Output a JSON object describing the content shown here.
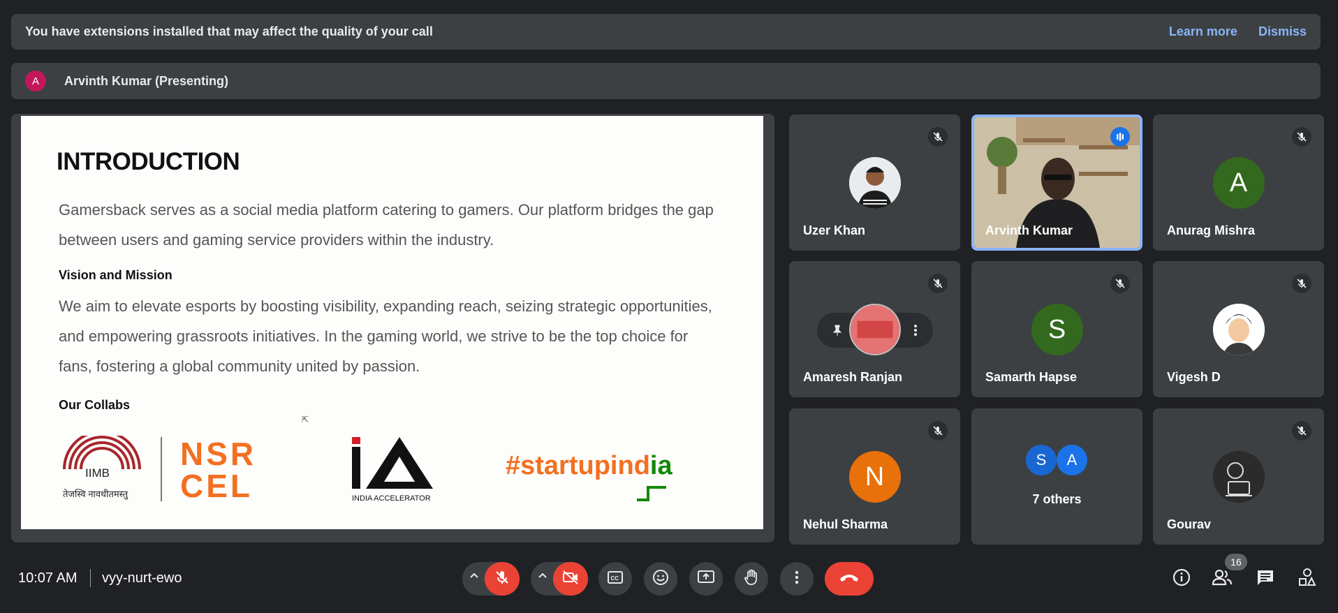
{
  "banner": {
    "message": "You have extensions installed that may affect the quality of your call",
    "learn_more": "Learn more",
    "dismiss": "Dismiss"
  },
  "presenting": {
    "avatar_letter": "A",
    "label": "Arvinth Kumar (Presenting)"
  },
  "slide": {
    "title": "INTRODUCTION",
    "intro_line1": "Gamersback serves as a social media platform catering to gamers.  Our platform bridges the gap",
    "intro_line2": "between users and gaming service providers within the industry.",
    "vision_heading": "Vision and Mission",
    "vision_line1": "We aim to elevate esports by boosting visibility, expanding reach, seizing strategic opportunities,",
    "vision_line2": "and empowering grassroots initiatives. In the gaming world, we strive to be the top choice for",
    "vision_line3": "fans, fostering a global community united by passion.",
    "collabs_heading": "Our Collabs",
    "collabs": {
      "iimb": "IIMB",
      "iimb_motto": "तेजस्वि नावधीतमस्तु",
      "nsr_line1": "NSR",
      "nsr_line2": "CEL",
      "india_accel": "INDIA ACCELERATOR",
      "startup_prefix": "#startupind",
      "startup_suffix": "ia"
    }
  },
  "participants": [
    {
      "name": "Uzer Khan"
    },
    {
      "name": "Arvinth Kumar"
    },
    {
      "name": "Anurag Mishra",
      "initial": "A"
    },
    {
      "name": "Amaresh Ranjan"
    },
    {
      "name": "Samarth Hapse",
      "initial": "S"
    },
    {
      "name": "Vigesh D"
    },
    {
      "name": "Nehul Sharma",
      "initial": "N"
    },
    {
      "name": "7 others",
      "initials": [
        "S",
        "A"
      ]
    },
    {
      "name": "Gourav"
    }
  ],
  "controls": {
    "time": "10:07 AM",
    "meeting_code": "vyy-nurt-ewo",
    "people_count": "16"
  },
  "colors": {
    "background": "#202124",
    "tile": "#3c4043",
    "accent_blue": "#8ab4f8",
    "danger_red": "#ea4335",
    "green_avatar": "#33691e",
    "orange_avatar": "#e8710a"
  }
}
